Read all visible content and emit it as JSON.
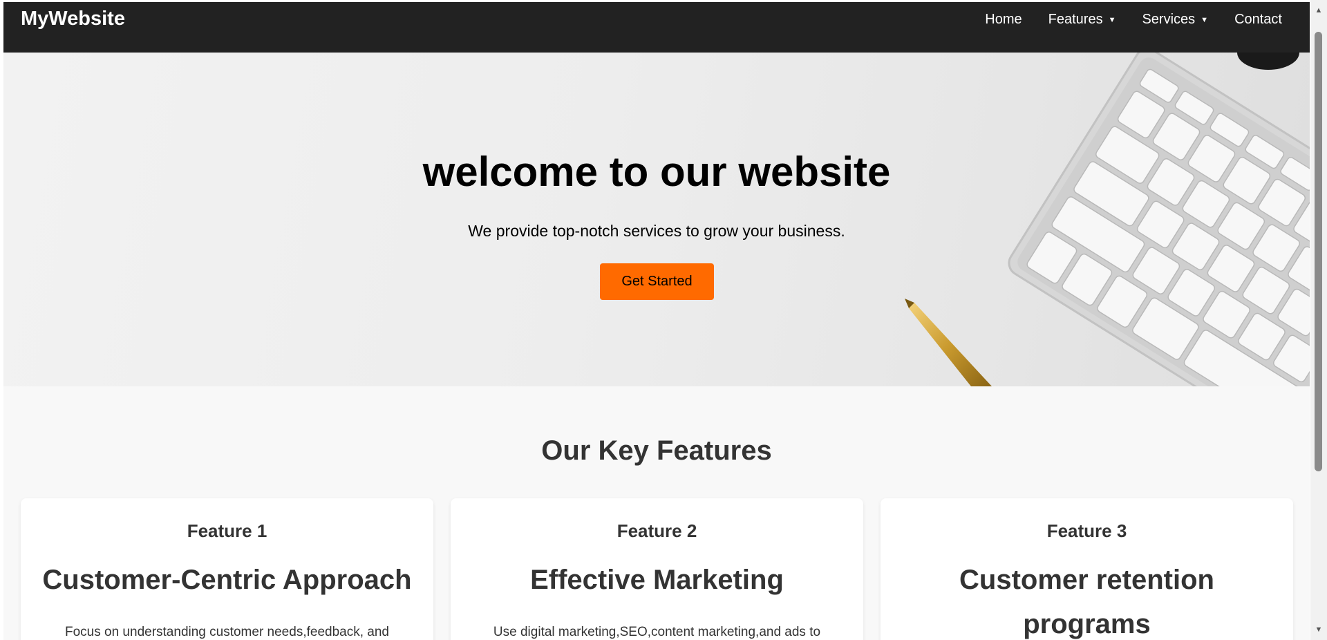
{
  "nav": {
    "brand": "MyWebsite",
    "links": [
      {
        "label": "Home",
        "dropdown": false
      },
      {
        "label": "Features",
        "dropdown": true
      },
      {
        "label": "Services",
        "dropdown": true
      },
      {
        "label": "Contact",
        "dropdown": false
      }
    ],
    "caret": "▼"
  },
  "hero": {
    "title": "welcome to our website",
    "subtitle": "We provide top-notch services to grow your business.",
    "cta": "Get Started"
  },
  "features": {
    "title": "Our Key Features",
    "cards": [
      {
        "label": "Feature 1",
        "heading": "Customer-Centric Approach",
        "text": "Focus on understanding customer needs,feedback, and"
      },
      {
        "label": "Feature 2",
        "heading": "Effective Marketing",
        "text": "Use digital marketing,SEO,content marketing,and ads to"
      },
      {
        "label": "Feature 3",
        "heading": "Customer retention programs",
        "text": ""
      }
    ]
  },
  "colors": {
    "navbar": "#222222",
    "accent": "#ff6a00",
    "page_bg": "#f8f8f8"
  }
}
